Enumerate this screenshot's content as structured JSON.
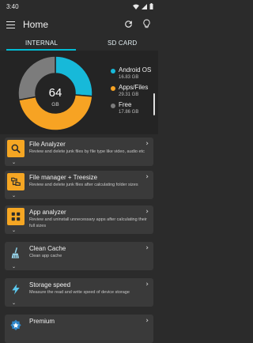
{
  "status_bar": {
    "time": "3:40"
  },
  "app_bar": {
    "title": "Home"
  },
  "tabs": [
    {
      "label": "INTERNAL"
    },
    {
      "label": "SD CARD"
    }
  ],
  "storage": {
    "center_value": "64",
    "center_unit": "GB",
    "legend": [
      {
        "name": "Android OS",
        "size": "16.83 GB",
        "color": "#17b9d9",
        "value": 16.83
      },
      {
        "name": "Apps/Files",
        "size": "29.31 GB",
        "color": "#f7a323",
        "value": 29.31
      },
      {
        "name": "Free",
        "size": "17.86 GB",
        "color": "#7c7c7c",
        "value": 17.86
      }
    ]
  },
  "tools": [
    {
      "title": "File Analyzer",
      "description": "Review and delete junk files by file type like video, audio etc",
      "icon": "magnifier-icon",
      "icon_bg": "#f5a623"
    },
    {
      "title": "File manager + Treesize",
      "description": "Review and delete junk files after calculating folder sizes",
      "icon": "folder-tree-icon",
      "icon_bg": "#f5a623"
    },
    {
      "title": "App analyzer",
      "description": "Review and uninstall unnecessary apps after calculating their full sizes",
      "icon": "apps-grid-icon",
      "icon_bg": "#f5a623"
    },
    {
      "title": "Clean Cache",
      "description": "Clean app cache",
      "icon": "broom-icon",
      "icon_bg": "#3a3a3a"
    },
    {
      "title": "Storage speed",
      "description": "Measure the read and write speed of device storage",
      "icon": "lightning-icon",
      "icon_bg": "#3a3a3a"
    },
    {
      "title": "Premium",
      "description": "",
      "icon": "premium-badge-icon",
      "icon_bg": "#3a3a3a"
    }
  ]
}
